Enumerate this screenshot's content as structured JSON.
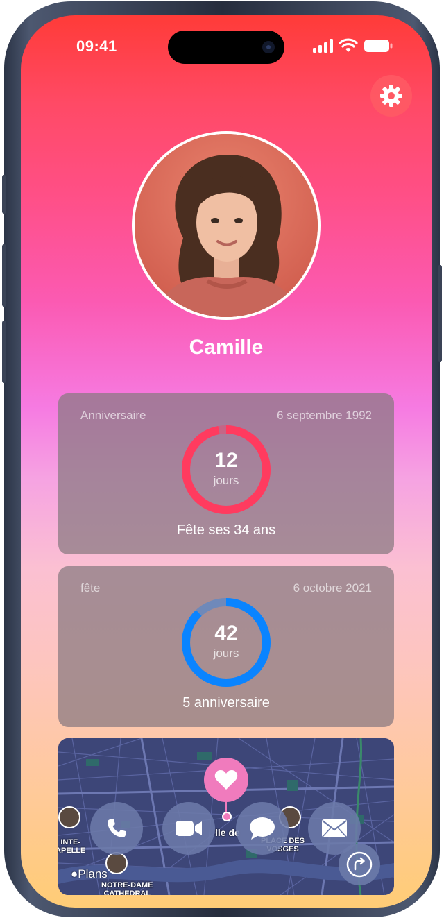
{
  "status": {
    "time": "09:41"
  },
  "profile": {
    "name": "Camille"
  },
  "cards": [
    {
      "label": "Anniversaire",
      "date": "6 septembre 1992",
      "count": "12",
      "unit": "jours",
      "subtitle": "Fête ses 34 ans",
      "progress": 0.97,
      "color": "#ff3b5f"
    },
    {
      "label": "fête",
      "date": "6 octobre 2021",
      "count": "42",
      "unit": "jours",
      "subtitle": "5 anniversaire",
      "progress": 0.88,
      "color": "#0a84ff"
    }
  ],
  "map": {
    "attribution": "Plans",
    "labels": [
      "INTE-\nAPELLE",
      "NOTRE-DAME\nCATHEDRAL",
      "PLACE DES\nVOSGES",
      "lle de"
    ],
    "actions": [
      "call",
      "video",
      "message",
      "mail"
    ]
  }
}
